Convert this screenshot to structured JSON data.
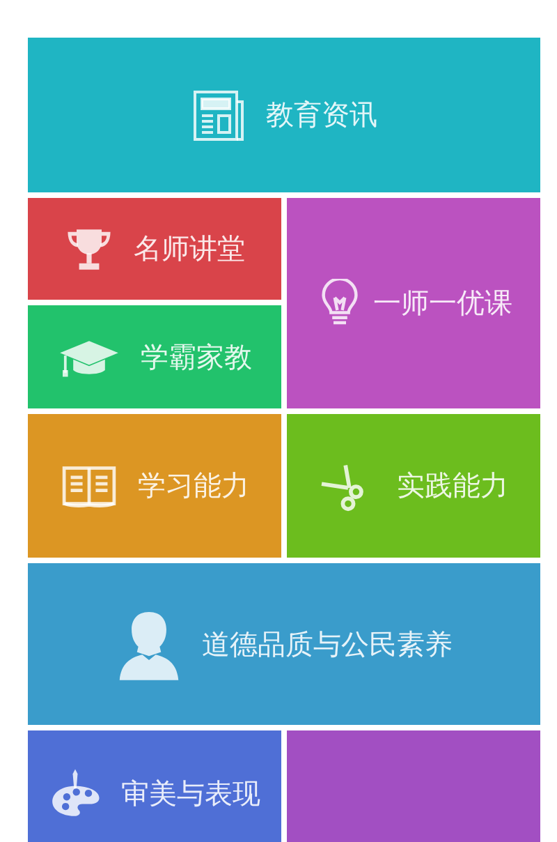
{
  "tiles": [
    {
      "kind": "wide",
      "label": "教育资讯",
      "color": "#1fb5c3"
    },
    {
      "kind": "half",
      "label": "名师讲堂",
      "color": "#d9444a"
    },
    {
      "kind": "tall",
      "label": "一师一优课",
      "color": "#bb52c0"
    },
    {
      "kind": "half",
      "label": "学霸家教",
      "color": "#22c26c"
    },
    {
      "kind": "half",
      "label": "学习能力",
      "color": "#dc9623"
    },
    {
      "kind": "half",
      "label": "实践能力",
      "color": "#6cbd1e"
    },
    {
      "kind": "wide",
      "label": "道德品质与公民素养",
      "color": "#3a9ccb"
    },
    {
      "kind": "half",
      "label": "审美与表现",
      "color": "#4f6fd6"
    },
    {
      "kind": "half",
      "color": "#a24fc2"
    }
  ]
}
